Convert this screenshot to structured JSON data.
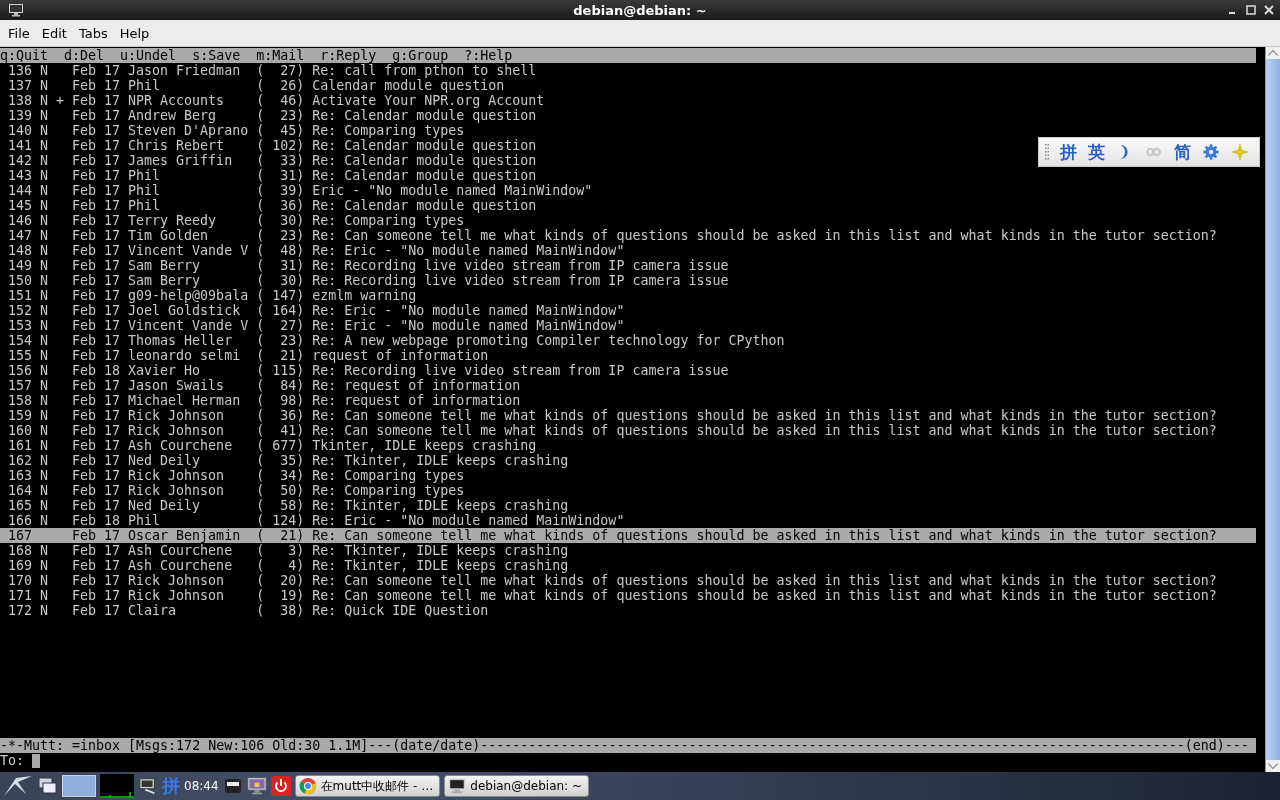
{
  "window": {
    "title": "debian@debian: ~"
  },
  "menu": [
    "File",
    "Edit",
    "Tabs",
    "Help"
  ],
  "terminal": {
    "help_line": "q:Quit  d:Del  u:Undel  s:Save  m:Mail  r:Reply  g:Group  ?:Help",
    "messages": [
      {
        "number": "136",
        "flags": "N",
        "date": "Feb 17",
        "from": "Jason Friedman",
        "size": "(  27)",
        "subject": "Re: call from pthon to shell",
        "selected": false
      },
      {
        "number": "137",
        "flags": "N",
        "date": "Feb 17",
        "from": "Phil",
        "size": "(  26)",
        "subject": "Calendar module question",
        "selected": false
      },
      {
        "number": "138",
        "flags": "N +",
        "date": "Feb 17",
        "from": "NPR Accounts",
        "size": "(  46)",
        "subject": "Activate Your NPR.org Account",
        "selected": false
      },
      {
        "number": "139",
        "flags": "N",
        "date": "Feb 17",
        "from": "Andrew Berg",
        "size": "(  23)",
        "subject": "Re: Calendar module question",
        "selected": false
      },
      {
        "number": "140",
        "flags": "N",
        "date": "Feb 17",
        "from": "Steven D'Aprano",
        "size": "(  45)",
        "subject": "Re: Comparing types",
        "selected": false
      },
      {
        "number": "141",
        "flags": "N",
        "date": "Feb 17",
        "from": "Chris Rebert",
        "size": "( 102)",
        "subject": "Re: Calendar module question",
        "selected": false
      },
      {
        "number": "142",
        "flags": "N",
        "date": "Feb 17",
        "from": "James Griffin",
        "size": "(  33)",
        "subject": "Re: Calendar module question",
        "selected": false
      },
      {
        "number": "143",
        "flags": "N",
        "date": "Feb 17",
        "from": "Phil",
        "size": "(  31)",
        "subject": "Re: Calendar module question",
        "selected": false
      },
      {
        "number": "144",
        "flags": "N",
        "date": "Feb 17",
        "from": "Phil",
        "size": "(  39)",
        "subject": "Eric - \"No module named MainWindow\"",
        "selected": false
      },
      {
        "number": "145",
        "flags": "N",
        "date": "Feb 17",
        "from": "Phil",
        "size": "(  36)",
        "subject": "Re: Calendar module question",
        "selected": false
      },
      {
        "number": "146",
        "flags": "N",
        "date": "Feb 17",
        "from": "Terry Reedy",
        "size": "(  30)",
        "subject": "Re: Comparing types",
        "selected": false
      },
      {
        "number": "147",
        "flags": "N",
        "date": "Feb 17",
        "from": "Tim Golden",
        "size": "(  23)",
        "subject": "Re: Can someone tell me what kinds of questions should be asked in this list and what kinds in the tutor section?",
        "selected": false
      },
      {
        "number": "148",
        "flags": "N",
        "date": "Feb 17",
        "from": "Vincent Vande V",
        "size": "(  48)",
        "subject": "Re: Eric - \"No module named MainWindow\"",
        "selected": false
      },
      {
        "number": "149",
        "flags": "N",
        "date": "Feb 17",
        "from": "Sam Berry",
        "size": "(  31)",
        "subject": "Re: Recording live video stream from IP camera issue",
        "selected": false
      },
      {
        "number": "150",
        "flags": "N",
        "date": "Feb 17",
        "from": "Sam Berry",
        "size": "(  30)",
        "subject": "Re: Recording live video stream from IP camera issue",
        "selected": false
      },
      {
        "number": "151",
        "flags": "N",
        "date": "Feb 17",
        "from": "g09-help@09bala",
        "size": "( 147)",
        "subject": "ezmlm warning",
        "selected": false
      },
      {
        "number": "152",
        "flags": "N",
        "date": "Feb 17",
        "from": "Joel Goldstick",
        "size": "( 164)",
        "subject": "Re: Eric - \"No module named MainWindow\"",
        "selected": false
      },
      {
        "number": "153",
        "flags": "N",
        "date": "Feb 17",
        "from": "Vincent Vande V",
        "size": "(  27)",
        "subject": "Re: Eric - \"No module named MainWindow\"",
        "selected": false
      },
      {
        "number": "154",
        "flags": "N",
        "date": "Feb 17",
        "from": "Thomas Heller",
        "size": "(  23)",
        "subject": "Re: A new webpage promoting Compiler technology for CPython",
        "selected": false
      },
      {
        "number": "155",
        "flags": "N",
        "date": "Feb 17",
        "from": "leonardo selmi",
        "size": "(  21)",
        "subject": "request of information",
        "selected": false
      },
      {
        "number": "156",
        "flags": "N",
        "date": "Feb 18",
        "from": "Xavier Ho",
        "size": "( 115)",
        "subject": "Re: Recording live video stream from IP camera issue",
        "selected": false
      },
      {
        "number": "157",
        "flags": "N",
        "date": "Feb 17",
        "from": "Jason Swails",
        "size": "(  84)",
        "subject": "Re: request of information",
        "selected": false
      },
      {
        "number": "158",
        "flags": "N",
        "date": "Feb 17",
        "from": "Michael Herman",
        "size": "(  98)",
        "subject": "Re: request of information",
        "selected": false
      },
      {
        "number": "159",
        "flags": "N",
        "date": "Feb 17",
        "from": "Rick Johnson",
        "size": "(  36)",
        "subject": "Re: Can someone tell me what kinds of questions should be asked in this list and what kinds in the tutor section?",
        "selected": false
      },
      {
        "number": "160",
        "flags": "N",
        "date": "Feb 17",
        "from": "Rick Johnson",
        "size": "(  41)",
        "subject": "Re: Can someone tell me what kinds of questions should be asked in this list and what kinds in the tutor section?",
        "selected": false
      },
      {
        "number": "161",
        "flags": "N",
        "date": "Feb 17",
        "from": "Ash Courchene",
        "size": "( 677)",
        "subject": "Tkinter, IDLE keeps crashing",
        "selected": false
      },
      {
        "number": "162",
        "flags": "N",
        "date": "Feb 17",
        "from": "Ned Deily",
        "size": "(  35)",
        "subject": "Re: Tkinter, IDLE keeps crashing",
        "selected": false
      },
      {
        "number": "163",
        "flags": "N",
        "date": "Feb 17",
        "from": "Rick Johnson",
        "size": "(  34)",
        "subject": "Re: Comparing types",
        "selected": false
      },
      {
        "number": "164",
        "flags": "N",
        "date": "Feb 17",
        "from": "Rick Johnson",
        "size": "(  50)",
        "subject": "Re: Comparing types",
        "selected": false
      },
      {
        "number": "165",
        "flags": "N",
        "date": "Feb 17",
        "from": "Ned Deily",
        "size": "(  58)",
        "subject": "Re: Tkinter, IDLE keeps crashing",
        "selected": false
      },
      {
        "number": "166",
        "flags": "N",
        "date": "Feb 18",
        "from": "Phil",
        "size": "( 124)",
        "subject": "Re: Eric - \"No module named MainWindow\"",
        "selected": false
      },
      {
        "number": "167",
        "date": "Feb 17",
        "from": "Oscar Benjamin",
        "size": "(  21)",
        "subject": "Re: Can someone tell me what kinds of questions should be asked in this list and what kinds in the tutor section?",
        "selected": true
      },
      {
        "number": "168",
        "flags": "N",
        "date": "Feb 17",
        "from": "Ash Courchene",
        "size": "(   3)",
        "subject": "Re: Tkinter, IDLE keeps crashing",
        "selected": false
      },
      {
        "number": "169",
        "flags": "N",
        "date": "Feb 17",
        "from": "Ash Courchene",
        "size": "(   4)",
        "subject": "Re: Tkinter, IDLE keeps crashing",
        "selected": false
      },
      {
        "number": "170",
        "flags": "N",
        "date": "Feb 17",
        "from": "Rick Johnson",
        "size": "(  20)",
        "subject": "Re: Can someone tell me what kinds of questions should be asked in this list and what kinds in the tutor section?",
        "selected": false
      },
      {
        "number": "171",
        "flags": "N",
        "date": "Feb 17",
        "from": "Rick Johnson",
        "size": "(  19)",
        "subject": "Re: Can someone tell me what kinds of questions should be asked in this list and what kinds in the tutor section?",
        "selected": false
      },
      {
        "number": "172",
        "flags": "N",
        "date": "Feb 17",
        "from": "Claira",
        "size": "(  38)",
        "subject": "Re: Quick IDE Question",
        "selected": false
      }
    ],
    "status_line": "-*-Mutt: =inbox [Msgs:172 New:106 Old:30 1.1M]---(date/date)----------------------------------------------------------------------------------------(end)---",
    "prompt": {
      "label": "To:"
    }
  },
  "ime_toolbar": {
    "buttons": [
      {
        "kind": "text",
        "label": "拼"
      },
      {
        "kind": "text",
        "label": "英"
      },
      {
        "kind": "moon"
      },
      {
        "kind": "link"
      },
      {
        "kind": "text",
        "label": "简"
      },
      {
        "kind": "gear"
      },
      {
        "kind": "star"
      }
    ]
  },
  "taskbar": {
    "input_method": "拼",
    "clock": "08:44",
    "tasks": [
      {
        "kind": "browser",
        "label": "在mutt中收邮件 - …"
      },
      {
        "kind": "terminal",
        "label": "debian@debian: ~"
      }
    ]
  }
}
